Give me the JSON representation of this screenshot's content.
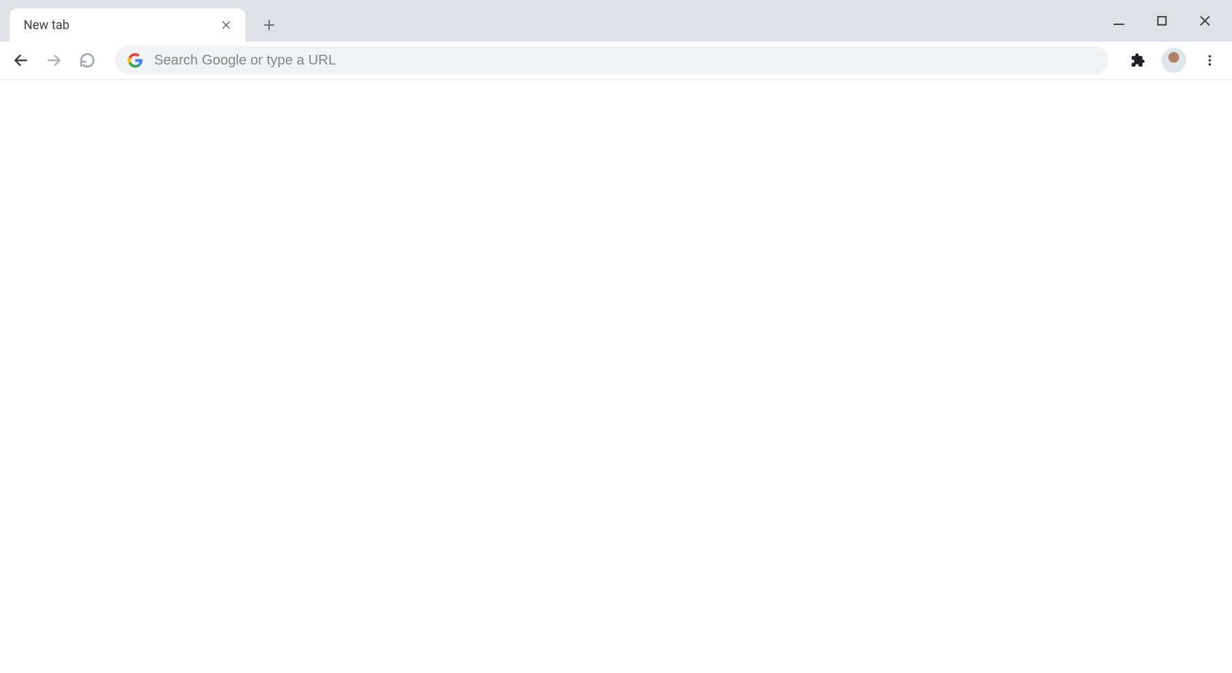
{
  "tabs": [
    {
      "title": "New tab"
    }
  ],
  "omnibox": {
    "placeholder": "Search Google or type a URL",
    "value": ""
  },
  "icons": {
    "close_tab": "close-icon",
    "new_tab": "plus-icon",
    "minimize": "minimize-icon",
    "maximize": "maximize-icon",
    "close_window": "close-icon",
    "back": "arrow-left-icon",
    "forward": "arrow-right-icon",
    "reload": "reload-icon",
    "search_engine": "google-g-icon",
    "extensions": "puzzle-icon",
    "profile": "avatar",
    "menu": "kebab-menu-icon"
  }
}
